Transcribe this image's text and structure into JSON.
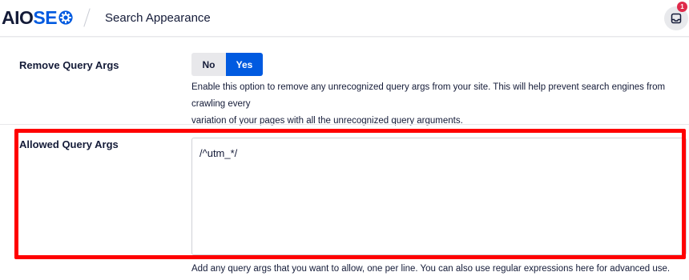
{
  "header": {
    "logo_aio": "AIO",
    "logo_seo": "SE",
    "page_title": "Search Appearance",
    "notification_count": "1"
  },
  "settings": {
    "remove_query_args": {
      "label": "Remove Query Args",
      "toggle_no": "No",
      "toggle_yes": "Yes",
      "selected": "Yes",
      "description_line1": "Enable this option to remove any unrecognized query args from your site. This will help prevent search engines from crawling every",
      "description_line2": "variation of your pages with all the unrecognized query arguments."
    },
    "allowed_query_args": {
      "label": "Allowed Query Args",
      "value": "/^utm_*/",
      "description": "Add any query args that you want to allow, one per line. You can also use regular expressions here for advanced use."
    }
  },
  "colors": {
    "brand_blue": "#005ae0",
    "highlight_red": "#ff0000",
    "badge_red": "#df2a4a"
  }
}
